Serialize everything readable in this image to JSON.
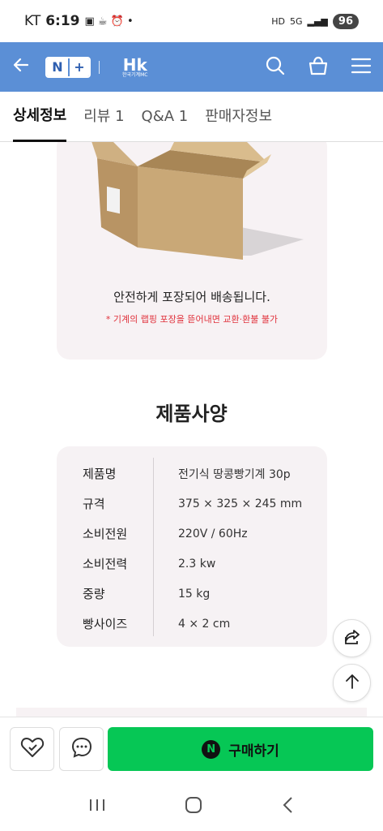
{
  "status_bar": {
    "carrier": "KT",
    "time": "6:19",
    "network": "5G",
    "battery": "96"
  },
  "app_bar": {
    "brand_text": "Hk",
    "brand_sub": "한국기계MC"
  },
  "tabs": [
    {
      "label": "상세정보",
      "active": true
    },
    {
      "label": "리뷰 1",
      "active": false
    },
    {
      "label": "Q&A 1",
      "active": false
    },
    {
      "label": "판매자정보",
      "active": false
    }
  ],
  "packaging": {
    "message": "안전하게 포장되어 배송됩니다.",
    "warning": "* 기계의 랩핑 포장을 뜯어내면 교환·환불 불가"
  },
  "specs": {
    "title": "제품사양",
    "rows": [
      {
        "key": "제품명",
        "value": "전기식 땅콩빵기계 30p"
      },
      {
        "key": "규격",
        "value": "375 × 325 × 245 mm"
      },
      {
        "key": "소비전원",
        "value": "220V / 60Hz"
      },
      {
        "key": "소비전력",
        "value": "2.3 kw"
      },
      {
        "key": "중량",
        "value": "15 kg"
      },
      {
        "key": "빵사이즈",
        "value": "4 × 2 cm"
      }
    ]
  },
  "buy_bar": {
    "buy_label": "구매하기",
    "buy_icon_letter": "N"
  },
  "icons": {
    "back": "arrow-left-icon",
    "search": "search-icon",
    "cart": "basket-icon",
    "menu": "hamburger-icon",
    "share": "share-icon",
    "top": "arrow-up-icon",
    "wish": "heart-icon",
    "chat": "chat-icon"
  },
  "colors": {
    "app_bar": "#5b8fd6",
    "buy_button": "#06c755",
    "warning": "#e0323c",
    "card_bg": "#f6f2f4"
  }
}
